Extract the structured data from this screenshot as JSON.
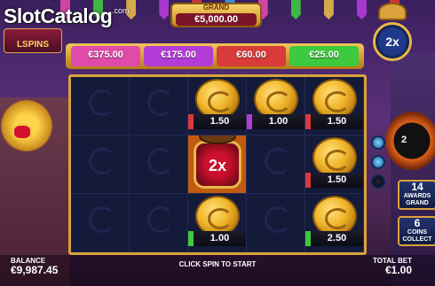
{
  "watermark": {
    "main": "SlotCatalog",
    "suffix": ".com"
  },
  "logo": {
    "subtitle": "LSPINS"
  },
  "grand": {
    "label": "GRAND",
    "value": "€5,000.00"
  },
  "jackpots": [
    {
      "value": "€375.00",
      "color": "#e04aa8"
    },
    {
      "value": "€175.00",
      "color": "#b33cd9"
    },
    {
      "value": "€60.00",
      "color": "#d93a3a"
    },
    {
      "value": "€25.00",
      "color": "#3ec93e"
    }
  ],
  "multiplier_badge": {
    "value": "2x"
  },
  "grid": {
    "rows": [
      [
        {
          "type": "empty"
        },
        {
          "type": "empty"
        },
        {
          "type": "coin",
          "value": "1.50",
          "color": "red"
        },
        {
          "type": "coin",
          "value": "1.00",
          "color": "purple"
        },
        {
          "type": "coin",
          "value": "1.50",
          "color": "red"
        }
      ],
      [
        {
          "type": "empty"
        },
        {
          "type": "empty"
        },
        {
          "type": "pot",
          "value": "2x"
        },
        {
          "type": "empty"
        },
        {
          "type": "coin",
          "value": "1.50",
          "color": "red"
        }
      ],
      [
        {
          "type": "empty"
        },
        {
          "type": "empty"
        },
        {
          "type": "coin",
          "value": "1.00",
          "color": "green"
        },
        {
          "type": "empty"
        },
        {
          "type": "coin",
          "value": "2.50",
          "color": "green"
        }
      ]
    ]
  },
  "wheel": {
    "value": "2"
  },
  "side_panels": [
    {
      "number": "14",
      "text": "AWARDS GRAND"
    },
    {
      "number": "6",
      "text": "COINS COLLECT"
    }
  ],
  "footer": {
    "balance_label": "BALANCE",
    "balance_value": "€9,987.45",
    "message": "CLICK SPIN TO START",
    "bet_label": "TOTAL BET",
    "bet_value": "€1.00"
  }
}
